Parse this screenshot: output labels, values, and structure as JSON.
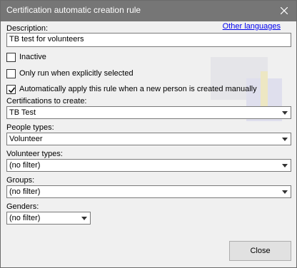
{
  "window": {
    "title": "Certification automatic creation rule"
  },
  "header": {
    "other_languages_link": "Other languages"
  },
  "description": {
    "label": "Description:",
    "value": "TB test for volunteers"
  },
  "checkboxes": [
    {
      "label": "Inactive",
      "checked": false
    },
    {
      "label": "Only run when explicitly selected",
      "checked": false
    },
    {
      "label": "Automatically apply this rule when a new person is created manually",
      "checked": true
    }
  ],
  "certifications": {
    "label": "Certifications to create:",
    "value": "TB Test"
  },
  "people_types": {
    "label": "People types:",
    "value": "Volunteer"
  },
  "volunteer_types": {
    "label": "Volunteer types:",
    "value": "(no filter)"
  },
  "groups": {
    "label": "Groups:",
    "value": "(no filter)"
  },
  "genders": {
    "label": "Genders:",
    "value": "(no filter)"
  },
  "footer": {
    "close_label": "Close"
  },
  "colors": {
    "titlebar": "#767676",
    "client": "#f0f0f0",
    "link": "#0000ee"
  }
}
